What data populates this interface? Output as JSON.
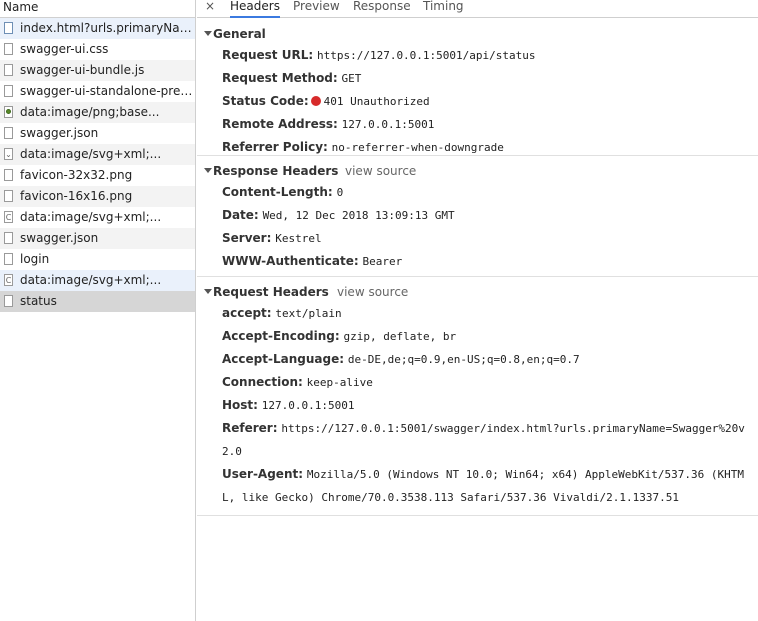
{
  "requests": {
    "header": "Name",
    "items": [
      {
        "label": "index.html?urls.primaryName=Swagger",
        "icon": "document-icon"
      },
      {
        "label": "swagger-ui.css",
        "icon": "document-icon"
      },
      {
        "label": "swagger-ui-bundle.js",
        "icon": "document-icon"
      },
      {
        "label": "swagger-ui-standalone-preset.js",
        "icon": "document-icon"
      },
      {
        "label": "data:image/png;base...",
        "icon": "image-icon"
      },
      {
        "label": "swagger.json",
        "icon": "document-icon"
      },
      {
        "label": "data:image/svg+xml;...",
        "icon": "svg-icon"
      },
      {
        "label": "favicon-32x32.png",
        "icon": "document-icon"
      },
      {
        "label": "favicon-16x16.png",
        "icon": "document-icon"
      },
      {
        "label": "data:image/svg+xml;...",
        "icon": "svg-icon"
      },
      {
        "label": "swagger.json",
        "icon": "document-icon"
      },
      {
        "label": "login",
        "icon": "document-icon"
      },
      {
        "label": "data:image/svg+xml;...",
        "icon": "svg-icon"
      },
      {
        "label": "status",
        "icon": "document-icon"
      }
    ]
  },
  "tabs": {
    "close": "×",
    "items": [
      "Headers",
      "Preview",
      "Response",
      "Timing"
    ]
  },
  "general": {
    "title": "General",
    "request_url_key": "Request URL:",
    "request_url": "https://127.0.0.1:5001/api/status",
    "request_method_key": "Request Method:",
    "request_method": "GET",
    "status_code_key": "Status Code:",
    "status_code": "401 Unauthorized",
    "status_color": "#d72a2a",
    "remote_address_key": "Remote Address:",
    "remote_address": "127.0.0.1:5001",
    "referrer_policy_key": "Referrer Policy:",
    "referrer_policy": "no-referrer-when-downgrade"
  },
  "response_headers": {
    "title": "Response Headers",
    "view_source": "view source",
    "items": [
      {
        "key": "Content-Length:",
        "value": "0"
      },
      {
        "key": "Date:",
        "value": "Wed, 12 Dec 2018 13:09:13 GMT"
      },
      {
        "key": "Server:",
        "value": "Kestrel"
      },
      {
        "key": "WWW-Authenticate:",
        "value": "Bearer"
      }
    ]
  },
  "request_headers": {
    "title": "Request Headers",
    "view_source": "view source",
    "items": [
      {
        "key": "accept:",
        "value": "text/plain"
      },
      {
        "key": "Accept-Encoding:",
        "value": "gzip, deflate, br"
      },
      {
        "key": "Accept-Language:",
        "value": "de-DE,de;q=0.9,en-US;q=0.8,en;q=0.7"
      },
      {
        "key": "Connection:",
        "value": "keep-alive"
      },
      {
        "key": "Host:",
        "value": "127.0.0.1:5001"
      },
      {
        "key": "Referer:",
        "value": "https://127.0.0.1:5001/swagger/index.html?urls.primaryName=Swagger%20v2.0"
      },
      {
        "key": "User-Agent:",
        "value": "Mozilla/5.0 (Windows NT 10.0; Win64; x64) AppleWebKit/537.36 (KHTML, like Gecko) Chrome/70.0.3538.113 Safari/537.36 Vivaldi/2.1.1337.51"
      }
    ]
  },
  "colors": {
    "tab_accent": "#3b7ae0",
    "selected_row": "#d6d6d6"
  }
}
